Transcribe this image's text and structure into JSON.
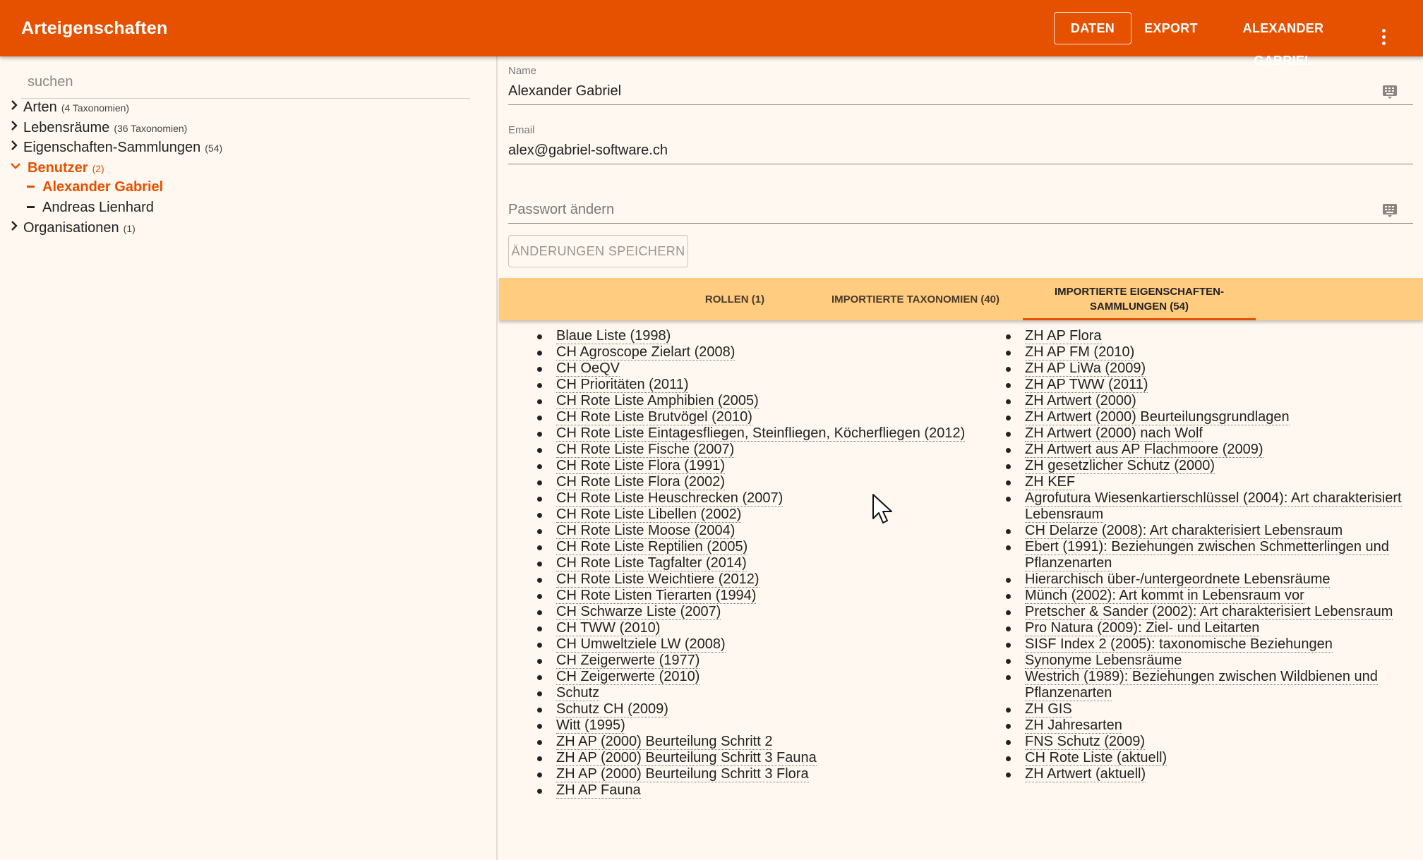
{
  "appbar": {
    "title": "Arteigenschaften",
    "nav": {
      "daten": "DATEN",
      "export": "EXPORT",
      "user": "ALEXANDER GABRIEL"
    },
    "color": "#e65100"
  },
  "sidebar": {
    "search_placeholder": "suchen",
    "tree": [
      {
        "label": "Arten",
        "count": "(4 Taxonomien)"
      },
      {
        "label": "Lebensräume",
        "count": "(36 Taxonomien)"
      },
      {
        "label": "Eigenschaften-Sammlungen",
        "count": "(54)"
      },
      {
        "label": "Benutzer",
        "count": "(2)"
      },
      {
        "label": "Organisationen",
        "count": "(1)"
      }
    ],
    "users": [
      "Alexander Gabriel",
      "Andreas Lienhard"
    ]
  },
  "form": {
    "name_label": "Name",
    "name_value": "Alexander Gabriel",
    "email_label": "Email",
    "email_value": "alex@gabriel-software.ch",
    "password_placeholder": "Passwort ändern",
    "save_label": "ÄNDERUNGEN SPEICHERN"
  },
  "tabs": {
    "roles": "ROLLEN (1)",
    "taxonomies": "IMPORTIERTE TAXONOMIEN (40)",
    "collections_line1": "IMPORTIERTE EIGENSCHAFTEN-",
    "collections_line2": "SAMMLUNGEN (54)"
  },
  "collections_left": [
    "Blaue Liste (1998)",
    "CH Agroscope Zielart (2008)",
    "CH OeQV",
    "CH Prioritäten (2011)",
    "CH Rote Liste Amphibien (2005)",
    "CH Rote Liste Brutvögel (2010)",
    "CH Rote Liste Eintagesfliegen, Steinfliegen, Köcherfliegen (2012)",
    "CH Rote Liste Fische (2007)",
    "CH Rote Liste Flora (1991)",
    "CH Rote Liste Flora (2002)",
    "CH Rote Liste Heuschrecken (2007)",
    "CH Rote Liste Libellen (2002)",
    "CH Rote Liste Moose (2004)",
    "CH Rote Liste Reptilien (2005)",
    "CH Rote Liste Tagfalter (2014)",
    "CH Rote Liste Weichtiere (2012)",
    "CH Rote Listen Tierarten (1994)",
    "CH Schwarze Liste (2007)",
    "CH TWW (2010)",
    "CH Umweltziele LW (2008)",
    "CH Zeigerwerte (1977)",
    "CH Zeigerwerte (2010)",
    "Schutz",
    "Schutz CH (2009)",
    "Witt (1995)",
    "ZH AP (2000) Beurteilung Schritt 2",
    "ZH AP (2000) Beurteilung Schritt 3 Fauna",
    "ZH AP (2000) Beurteilung Schritt 3 Flora",
    "ZH AP Fauna"
  ],
  "collections_right": [
    "ZH AP Flora",
    "ZH AP FM (2010)",
    "ZH AP LiWa (2009)",
    "ZH AP TWW (2011)",
    "ZH Artwert (2000)",
    "ZH Artwert (2000) Beurteilungsgrundlagen",
    "ZH Artwert (2000) nach Wolf",
    "ZH Artwert aus AP Flachmoore (2009)",
    "ZH gesetzlicher Schutz (2000)",
    "ZH KEF",
    "Agrofutura Wiesenkartierschlüssel (2004): Art charakterisiert Lebensraum",
    "CH Delarze (2008): Art charakterisiert Lebensraum",
    "Ebert (1991): Beziehungen zwischen Schmetterlingen und Pflanzenarten",
    "Hierarchisch über-/untergeordnete Lebensräume",
    "Münch (2002): Art kommt in Lebensraum vor",
    "Pretscher & Sander (2002): Art charakterisiert Lebensraum",
    "Pro Natura (2009): Ziel- und Leitarten",
    "SISF Index 2 (2005): taxonomische Beziehungen",
    "Synonyme Lebensräume",
    "Westrich (1989): Beziehungen zwischen Wildbienen und Pflanzenarten",
    "ZH GIS",
    "ZH Jahresarten",
    "FNS Schutz (2009)",
    "CH Rote Liste (aktuell)",
    "ZH Artwert (aktuell)"
  ]
}
